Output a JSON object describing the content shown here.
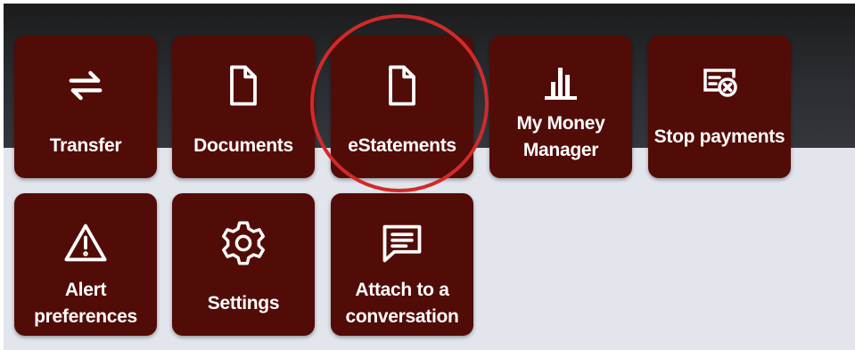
{
  "tiles_row1": [
    {
      "label": "Transfer",
      "icon": "transfer-arrows-icon"
    },
    {
      "label": "Documents",
      "icon": "document-icon"
    },
    {
      "label": "eStatements",
      "icon": "document-icon"
    },
    {
      "label": "My Money Manager",
      "icon": "bar-chart-icon"
    },
    {
      "label": "Stop payments",
      "icon": "stop-check-icon"
    }
  ],
  "tiles_row2": [
    {
      "label": "Alert preferences",
      "icon": "warning-icon"
    },
    {
      "label": "Settings",
      "icon": "gear-icon"
    },
    {
      "label": "Attach to a conversation",
      "icon": "chat-bubble-icon"
    }
  ],
  "colors": {
    "tile_background": "#520c07",
    "tile_text": "#ffffff",
    "header_background": "#2a2d31",
    "page_background": "#e2e5ec",
    "highlight_circle": "#d12a2a"
  }
}
